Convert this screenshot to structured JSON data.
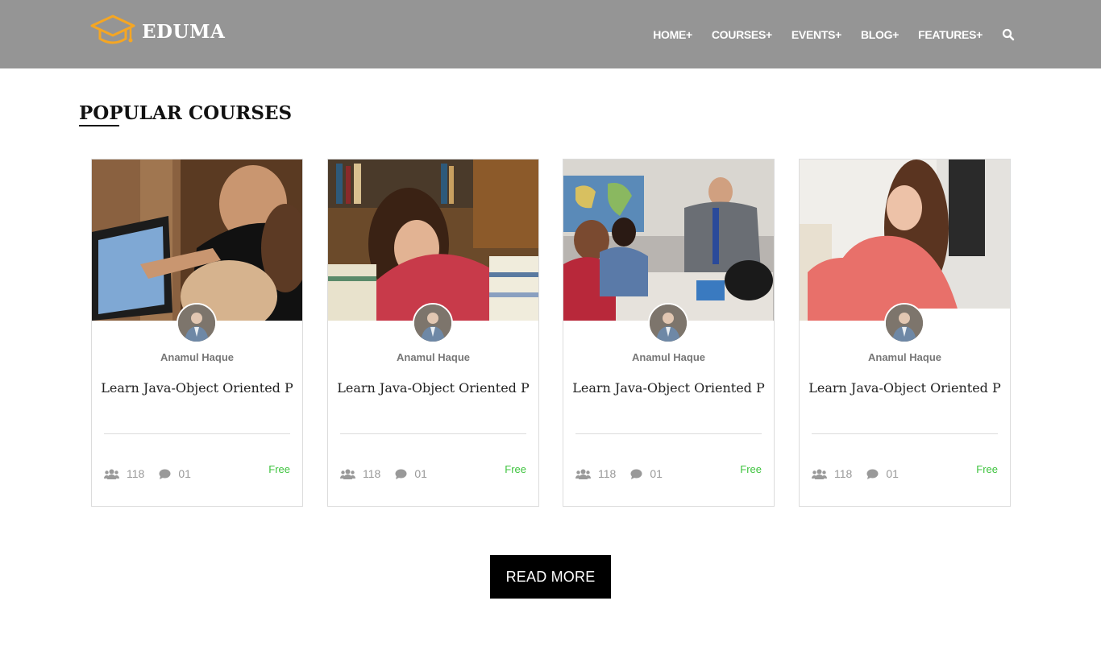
{
  "header": {
    "logo_text": "EDUMA",
    "logo_icon": "graduation-cap-icon",
    "nav": [
      {
        "label": "HOME+"
      },
      {
        "label": "COURSES+"
      },
      {
        "label": "EVENTS+"
      },
      {
        "label": "BLOG+"
      },
      {
        "label": "FEATURES+"
      }
    ],
    "search_icon": "search-icon"
  },
  "section": {
    "title": "POPULAR COURSES"
  },
  "courses": [
    {
      "author": "Anamul Haque",
      "title": "Learn Java-Object Oriented P",
      "students": "118",
      "comments": "01",
      "price": "Free"
    },
    {
      "author": "Anamul Haque",
      "title": "Learn Java-Object Oriented P",
      "students": "118",
      "comments": "01",
      "price": "Free"
    },
    {
      "author": "Anamul Haque",
      "title": "Learn Java-Object Oriented P",
      "students": "118",
      "comments": "01",
      "price": "Free"
    },
    {
      "author": "Anamul Haque",
      "title": "Learn Java-Object Oriented P",
      "students": "118",
      "comments": "01",
      "price": "Free"
    }
  ],
  "read_more_label": "READ MORE",
  "colors": {
    "header_bg": "#959595",
    "logo_accent": "#f5a623",
    "price": "#3ec33e",
    "button_bg": "#000000"
  }
}
